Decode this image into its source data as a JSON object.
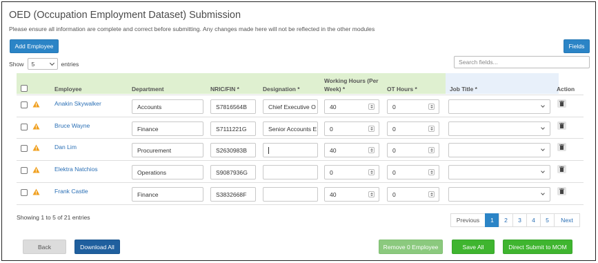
{
  "page": {
    "title": "OED (Occupation Employment Dataset) Submission",
    "subtitle": "Please ensure all information are complete and correct before submitting. Any changes made here will not be reflected in the other modules"
  },
  "toolbar": {
    "add_employee": "Add Employee",
    "fields": "Fields"
  },
  "length_menu": {
    "prefix": "Show",
    "value": "5",
    "suffix": "entries"
  },
  "search": {
    "placeholder": "Search fields..."
  },
  "table": {
    "headers": {
      "employee": "Employee",
      "department": "Department",
      "nric": "NRIC/FIN *",
      "designation": "Designation *",
      "working_hours_1": "Working Hours (Per",
      "working_hours_2": "Week) *",
      "ot_hours": "OT Hours *",
      "job_title": "Job Title *",
      "action": "Action"
    },
    "rows": [
      {
        "name": "Anakin Skywalker",
        "department": "Accounts",
        "nric": "S7816564B",
        "designation": "Chief Executive O",
        "working_hours": "40",
        "ot_hours": "0",
        "job_title": ""
      },
      {
        "name": "Bruce Wayne",
        "department": "Finance",
        "nric": "S7111221G",
        "designation": "Senior Accounts E",
        "working_hours": "0",
        "ot_hours": "0",
        "job_title": ""
      },
      {
        "name": "Dan Lim",
        "department": "Procurement",
        "nric": "S2630983B",
        "designation": "",
        "working_hours": "40",
        "ot_hours": "0",
        "job_title": ""
      },
      {
        "name": "Elektra Natchios",
        "department": "Operations",
        "nric": "S9087936G",
        "designation": "",
        "working_hours": "0",
        "ot_hours": "0",
        "job_title": ""
      },
      {
        "name": "Frank Castle",
        "department": "Finance",
        "nric": "S3832668F",
        "designation": "",
        "working_hours": "40",
        "ot_hours": "0",
        "job_title": ""
      }
    ]
  },
  "footer": {
    "info": "Showing 1 to 5 of 21 entries",
    "pagination": {
      "previous": "Previous",
      "pages": [
        "1",
        "2",
        "3",
        "4",
        "5"
      ],
      "next": "Next",
      "active_page": "1"
    }
  },
  "actions": {
    "back": "Back",
    "download_all": "Download All",
    "remove": "Remove 0 Employee",
    "save_all": "Save All",
    "direct_submit": "Direct Submit to MOM"
  },
  "colors": {
    "primary": "#2b84c6",
    "navy": "#1f5f9e",
    "green": "#3fb52f",
    "light_green": "#8bc97e",
    "header_green": "#dff0d0",
    "header_blue": "#e8f0fa",
    "warning": "#f0a020",
    "link": "#2a6fb5"
  }
}
